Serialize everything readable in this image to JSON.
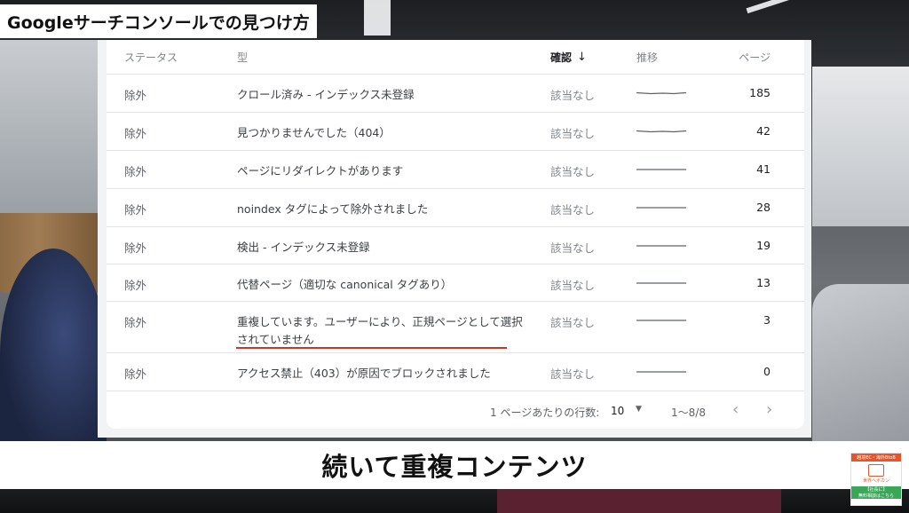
{
  "video": {
    "title_tag": "Googleサーチコンソールでの見つけ方",
    "caption": "続いて重複コンテンツ"
  },
  "table": {
    "headers": {
      "status": "ステータス",
      "type": "型",
      "check": "確認",
      "trend": "推移",
      "pages": "ページ"
    },
    "rows": [
      {
        "status": "除外",
        "type": "クロール済み - インデックス未登録",
        "check": "該当なし",
        "pages": "185"
      },
      {
        "status": "除外",
        "type": "見つかりませんでした（404）",
        "check": "該当なし",
        "pages": "42"
      },
      {
        "status": "除外",
        "type": "ページにリダイレクトがあります",
        "check": "該当なし",
        "pages": "41"
      },
      {
        "status": "除外",
        "type": "noindex タグによって除外されました",
        "check": "該当なし",
        "pages": "28"
      },
      {
        "status": "除外",
        "type": "検出 - インデックス未登録",
        "check": "該当なし",
        "pages": "19"
      },
      {
        "status": "除外",
        "type": "代替ページ（適切な canonical タグあり）",
        "check": "該当なし",
        "pages": "13"
      },
      {
        "status": "除外",
        "type": "重複しています。ユーザーにより、正規ページとして選択されていません",
        "check": "該当なし",
        "pages": "3"
      },
      {
        "status": "除外",
        "type": "アクセス禁止（403）が原因でブロックされました",
        "check": "該当なし",
        "pages": "0"
      }
    ],
    "footer": {
      "rows_per_page_label": "1 ページあたりの行数:",
      "rows_per_page_value": "10",
      "range": "1～8/8"
    }
  },
  "promo": {
    "top": "越境EC・海外BtoB",
    "name": "世界へボカン",
    "bottom1": "【社長に】",
    "bottom2": "無料相談はこちら"
  },
  "icons": {
    "sort": "arrow-down-icon",
    "dropdown": "caret-down-icon",
    "prev": "chevron-left-icon",
    "next": "chevron-right-icon"
  },
  "colors": {
    "highlight_underline": "#d93025",
    "trend_line": "#5f6368"
  }
}
